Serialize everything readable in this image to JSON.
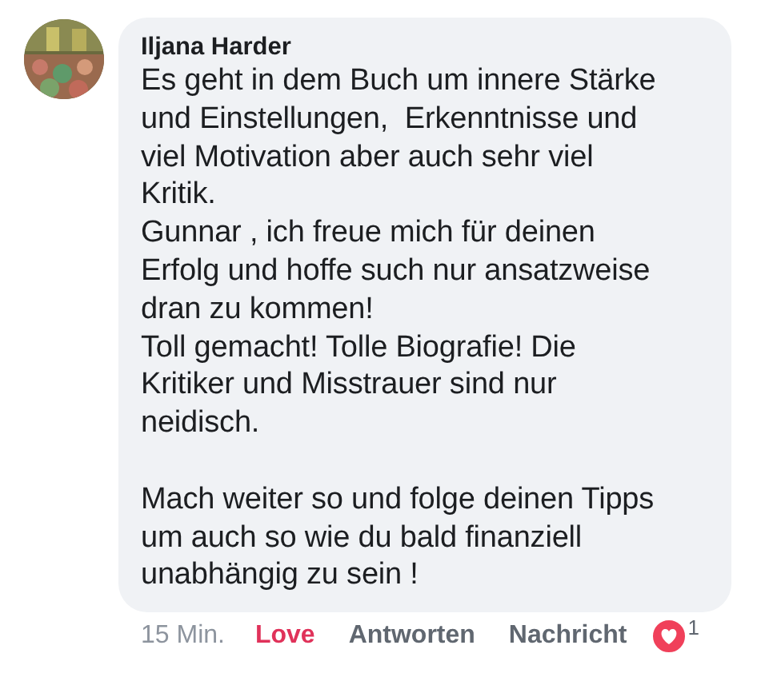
{
  "comment": {
    "author": "Iljana Harder",
    "paragraphs": [
      {
        "lines": [
          "Es geht in dem Buch um innere Stärke",
          "und Einstellungen,  Erkenntnisse und",
          "viel Motivation aber auch sehr viel",
          "Kritik."
        ],
        "gap_before": false
      },
      {
        "lines": [
          "Gunnar , ich freue mich für deinen",
          "Erfolg und hoffe such nur ansatzweise",
          "dran zu kommen!"
        ],
        "gap_before": false
      },
      {
        "lines": [
          "Toll gemacht! Tolle Biografie! Die",
          "Kritiker und Misstrauer sind nur",
          "neidisch."
        ],
        "gap_before": false
      },
      {
        "lines": [
          "Mach weiter so und folge deinen Tipps",
          "um auch so wie du bald finanziell",
          "unabhängig zu sein !"
        ],
        "gap_before": true
      }
    ]
  },
  "footer": {
    "time": "15 Min.",
    "actions": [
      {
        "label": "Love",
        "selected": true
      },
      {
        "label": "Antworten",
        "selected": false
      },
      {
        "label": "Nachricht",
        "selected": false
      }
    ],
    "reaction_count": "1"
  }
}
